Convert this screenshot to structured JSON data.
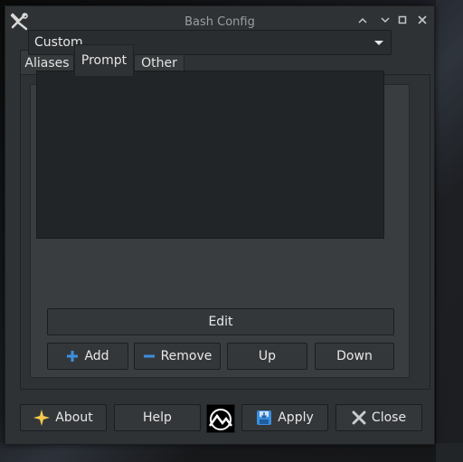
{
  "window": {
    "title": "Bash Config"
  },
  "tabs": [
    {
      "label": "Aliases"
    },
    {
      "label": "Prompt"
    },
    {
      "label": "Other"
    }
  ],
  "active_tab": "Prompt",
  "prompt": {
    "combo_value": "Custom",
    "buttons": {
      "edit": "Edit",
      "add": "Add",
      "remove": "Remove",
      "up": "Up",
      "down": "Down"
    }
  },
  "footer": {
    "about": "About",
    "help": "Help",
    "apply": "Apply",
    "close": "Close"
  },
  "icons": {
    "app": "tools-icon",
    "add": "plus-icon",
    "remove": "minus-icon",
    "about": "star-icon",
    "logo": "mx-logo-icon",
    "apply": "save-icon",
    "close": "close-icon"
  },
  "colors": {
    "window_bg": "#2f3234",
    "list_bg": "#222527",
    "accent_blue": "#3d8fe0",
    "star_yellow": "#f2c94c"
  }
}
